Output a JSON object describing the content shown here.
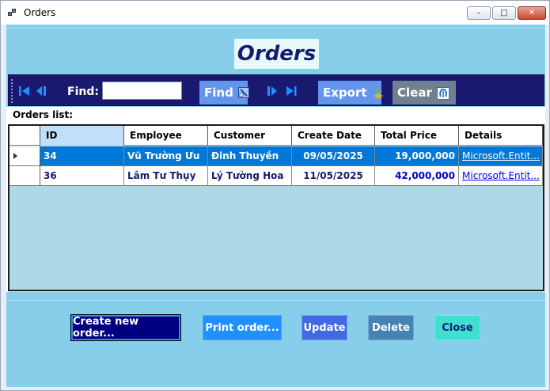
{
  "window": {
    "title": "Orders",
    "controls": {
      "minimize": "–",
      "maximize": "□",
      "close": "✕"
    }
  },
  "header": {
    "title": "Orders"
  },
  "toolbar": {
    "find_label": "Find:",
    "find_value": "",
    "find_button": "Find",
    "export_button": "Export",
    "clear_button": "Clear",
    "nav_icons": [
      "first-record-icon",
      "previous-record-icon",
      "next-record-icon",
      "last-record-icon"
    ]
  },
  "orders_list": {
    "label": "Orders list:",
    "columns": [
      "ID",
      "Employee",
      "Customer",
      "Create Date",
      "Total Price",
      "Details"
    ],
    "rows": [
      {
        "id": "34",
        "employee": "Vũ Trường Ưu",
        "customer": "Đinh Thuyền",
        "create_date": "09/05/2025",
        "total_price": "19,000,000",
        "details": "Microsoft.Entit...",
        "selected": true
      },
      {
        "id": "36",
        "employee": "Lâm Tư Thụy",
        "customer": "Lý Tường Hoa",
        "create_date": "11/05/2025",
        "total_price": "42,000,000",
        "details": "Microsoft.Entit...",
        "selected": false
      }
    ]
  },
  "actions": {
    "create": "Create new order...",
    "print": "Print order...",
    "update": "Update",
    "delete": "Delete",
    "close": "Close"
  },
  "colors": {
    "panel_background": "#87ceeb",
    "toolbar_background": "#191970",
    "grid_background": "#add8e6",
    "selected_row": "#0078d7"
  }
}
